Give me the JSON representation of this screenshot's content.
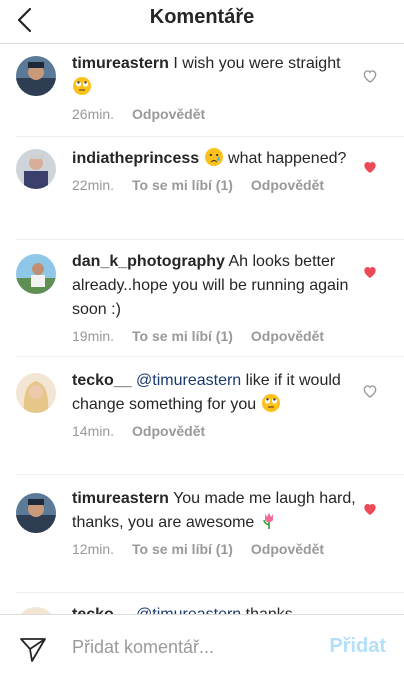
{
  "header": {
    "title": "Komentáře"
  },
  "comments": [
    {
      "user": "timureastern",
      "text": " I wish you were straight ",
      "time": "26min.",
      "likes": "",
      "reply": "Odpovědět",
      "liked": false
    },
    {
      "user": "indiatheprincess",
      "text": "  what happened?",
      "time": "22min.",
      "likes": "To se mi líbí (1)",
      "reply": "Odpovědět",
      "liked": true
    },
    {
      "user": "dan_k_photography",
      "text": " Ah looks better already..hope you will be running again soon :)",
      "time": "19min.",
      "likes": "To se mi líbí (1)",
      "reply": "Odpovědět",
      "liked": true
    },
    {
      "user": "tecko__",
      "mention": " @timureastern",
      "text": " like if it would change something for you ",
      "time": "14min.",
      "likes": "",
      "reply": "Odpovědět",
      "liked": false
    },
    {
      "user": "timureastern",
      "text": " You made me laugh hard, thanks, you are awesome ",
      "time": "12min.",
      "likes": "To se mi líbí (1)",
      "reply": "Odpovědět",
      "liked": true
    },
    {
      "user": "tecko__",
      "mention": " @timureastern",
      "text": " thanks",
      "time": "",
      "likes": "",
      "reply": "",
      "liked": false
    }
  ],
  "footer": {
    "placeholder": "Přidat komentář...",
    "post_label": "Přidat"
  },
  "colors": {
    "heart_liked": "#ed4956",
    "heart_unliked": "#999999",
    "post_disabled": "#b2dffc"
  },
  "icons": {
    "back": "chevron-left-icon",
    "send": "paper-plane-icon",
    "like": "heart-icon"
  }
}
